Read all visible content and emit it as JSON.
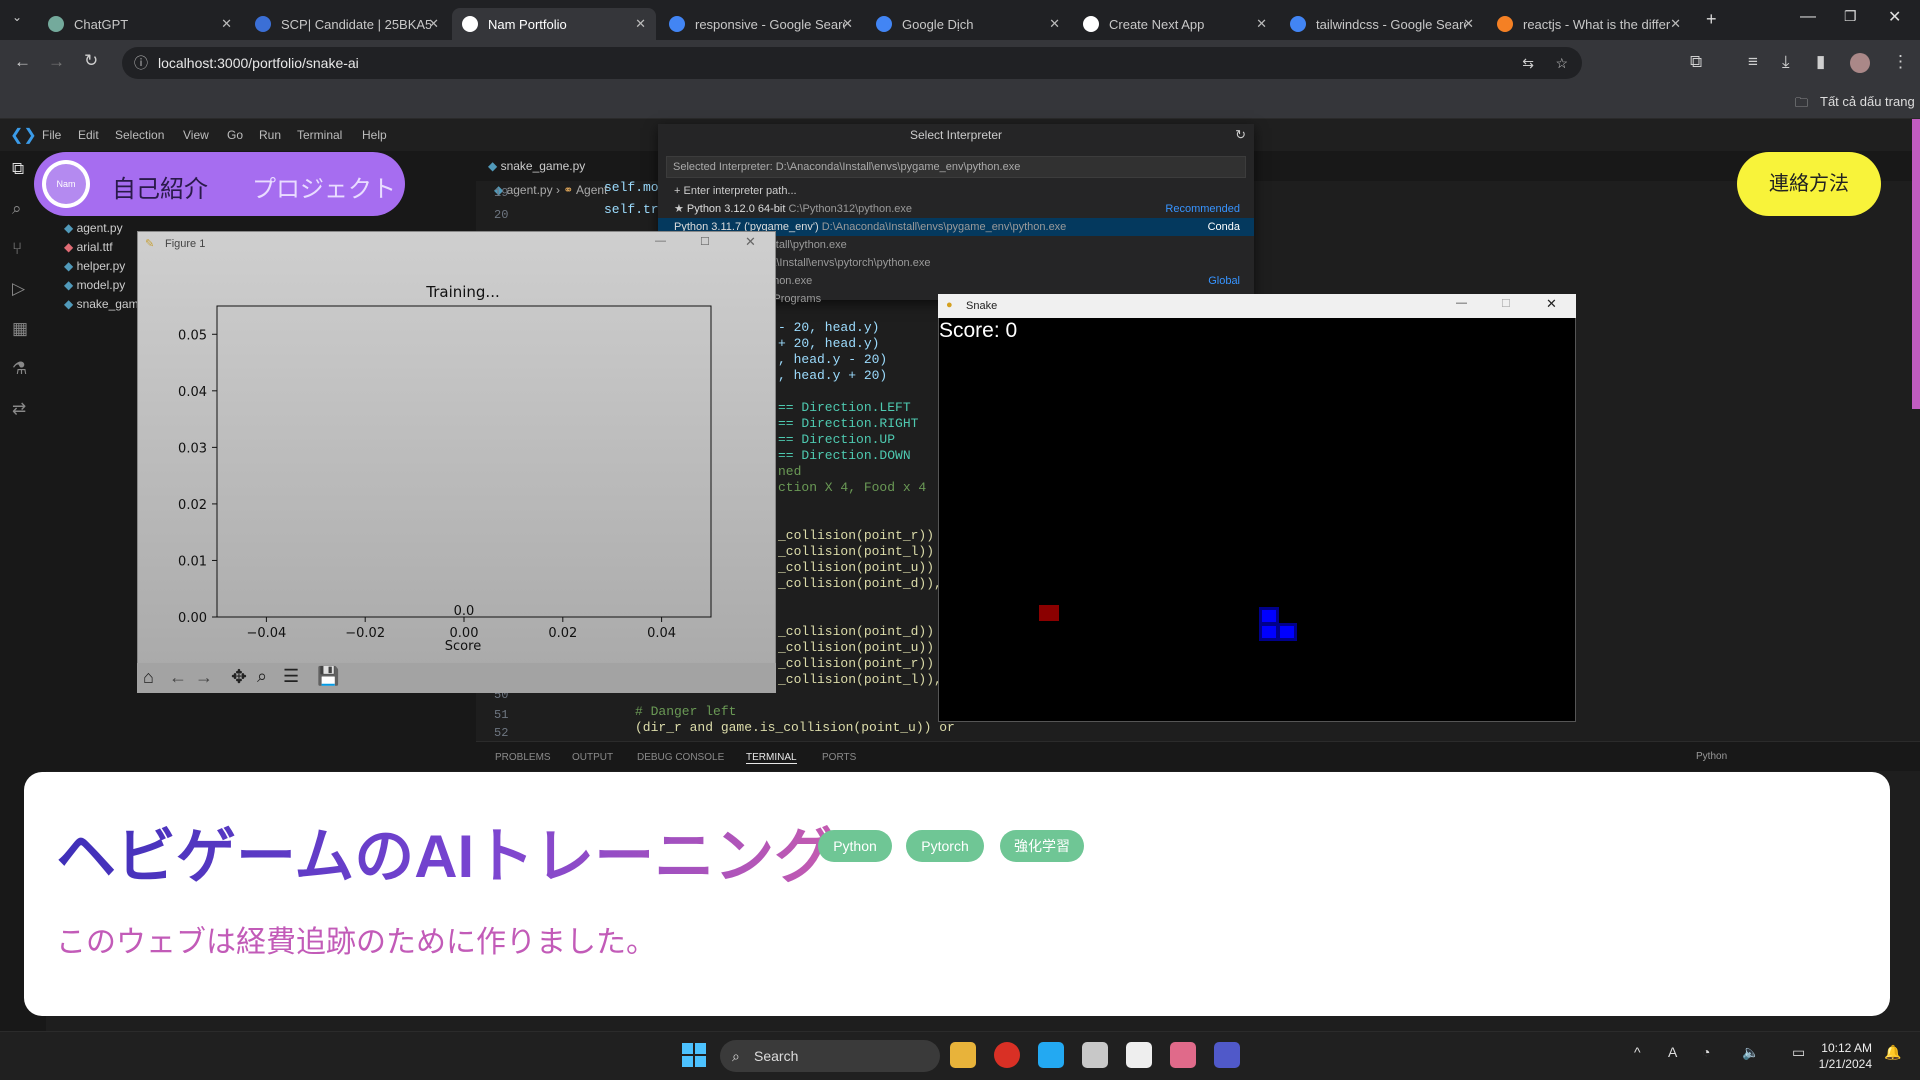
{
  "browser": {
    "tabs": [
      {
        "title": "ChatGPT",
        "color": "#74aa9c"
      },
      {
        "title": "SCP| Candidate | 25BKA58",
        "color": "#3b6fd6"
      },
      {
        "title": "Nam Portfolio",
        "color": "#ffffff"
      },
      {
        "title": "responsive - Google Search",
        "color": "#4285f4"
      },
      {
        "title": "Google Dịch",
        "color": "#4285f4"
      },
      {
        "title": "Create Next App",
        "color": "#ffffff"
      },
      {
        "title": "tailwindcss - Google Search",
        "color": "#4285f4"
      },
      {
        "title": "reactjs - What is the differ",
        "color": "#f48024"
      }
    ],
    "url": "localhost:3000/portfolio/snake-ai",
    "bookmarks_label": "Tất cả dấu trang"
  },
  "vscode": {
    "menu": [
      "File",
      "Edit",
      "Selection",
      "View",
      "Go",
      "Run",
      "Terminal",
      "Help"
    ],
    "files": [
      "agent.py",
      "arial.ttf",
      "helper.py",
      "model.py",
      "snake_gam"
    ],
    "editor_tab": "snake_game.py",
    "breadcrumb": [
      "agent.py",
      "Agent"
    ],
    "line_numbers": [
      "19",
      "20",
      "21",
      "50",
      "51",
      "52"
    ],
    "code_lines": [
      "self.mo",
      "self.tr",
      "- 20, head.y)",
      "+ 20, head.y)",
      ", head.y - 20)",
      ", head.y + 20)",
      "== Direction.LEFT",
      "== Direction.RIGHT",
      "== Direction.UP",
      "== Direction.DOWN",
      "ned",
      "ction X 4, Food x 4",
      "_collision(point_r)) o",
      "_collision(point_l)) o",
      "_collision(point_u)) o",
      "_collision(point_d)),",
      "_collision(point_d)) o",
      "_collision(point_u)) o",
      "_collision(point_r)) o",
      "_collision(point_l)),",
      "# Danger left",
      "(dir_r and game.is_collision(point_u)) or"
    ],
    "panel_tabs": [
      "PROBLEMS",
      "OUTPUT",
      "DEBUG CONSOLE",
      "TERMINAL",
      "PORTS"
    ],
    "panel_right": "Python"
  },
  "interpreter": {
    "title": "Select Interpreter",
    "selected": "Selected Interpreter: D:\\Anaconda\\Install\\envs\\pygame_env\\python.exe",
    "enter_path": "Enter interpreter path...",
    "rows": [
      {
        "name": "Python 3.12.0 64-bit",
        "path": "C:\\Python312\\python.exe",
        "tag": "Recommended"
      },
      {
        "name": "Python 3.11.7 ('pygame_env')",
        "path": "D:\\Anaconda\\Install\\envs\\pygame_env\\python.exe",
        "tag": "Conda"
      },
      {
        "name": "se')",
        "path": "D:\\Anaconda\\Install\\python.exe",
        "tag": ""
      },
      {
        "name": "ytorch')",
        "path": "D:\\Anaconda\\Install\\envs\\pytorch\\python.exe",
        "tag": ""
      },
      {
        "name": "bit",
        "path": "C:\\Python312\\python.exe",
        "tag": "Global"
      },
      {
        "name": "bit",
        "path": "~\\AppData\\Local\\Programs",
        "tag": ""
      }
    ]
  },
  "figure": {
    "window_title": "Figure 1"
  },
  "chart_data": {
    "type": "line",
    "title": "Training...",
    "xlabel": "Score",
    "ylabel": "",
    "xlim": [
      -0.05,
      0.05
    ],
    "ylim": [
      0,
      0.055
    ],
    "x_ticks": [
      "−0.04",
      "−0.02",
      "0.00",
      "0.02",
      "0.04"
    ],
    "y_ticks": [
      "0.00",
      "0.01",
      "0.02",
      "0.03",
      "0.04",
      "0.05"
    ],
    "annotations": [
      {
        "text": "0.0",
        "x": 0,
        "y": 0
      }
    ],
    "series": []
  },
  "snake": {
    "window_title": "Snake",
    "score_text": "Score: 0",
    "food_color": "#8b0000",
    "snake_color": "#0000ff"
  },
  "portfolio": {
    "nav": {
      "about": "自己紹介",
      "projects": "プロジェクト",
      "logo": "Nam"
    },
    "contact": "連絡方法",
    "title": "ヘビゲームのAIトレーニング",
    "tags": [
      "Python",
      "Pytorch",
      "強化学習"
    ],
    "description": "このウェブは経費追跡のために作りました。"
  },
  "taskbar": {
    "search": "Search",
    "time": "10:12 AM",
    "date": "1/21/2024"
  }
}
